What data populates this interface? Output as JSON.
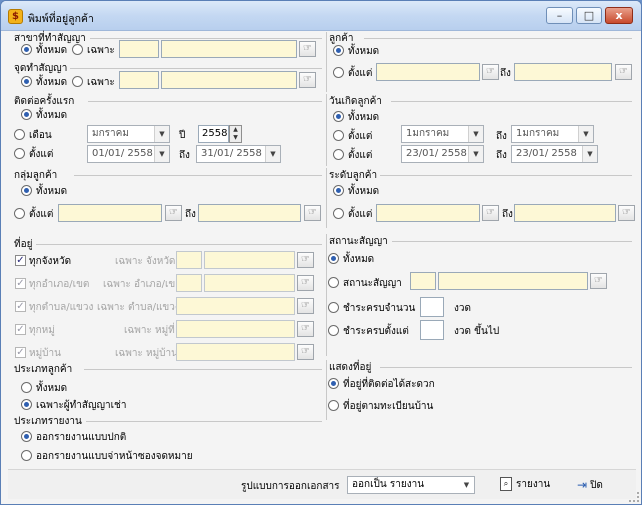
{
  "window": {
    "title": "พิมพ์ที่อยู่ลูกค้า",
    "minimize": "–",
    "maximize": "□",
    "close": "x"
  },
  "branch": {
    "title": "สาขาที่ทำสัญญา",
    "all": "ทั้งหมด",
    "specific": "เฉพาะ"
  },
  "contract_point": {
    "title": "จุดทำสัญญา",
    "all": "ทั้งหมด",
    "specific": "เฉพาะ"
  },
  "customer": {
    "title": "ลูกค้า",
    "all": "ทั้งหมด",
    "from": "ตั้งแต่",
    "to": "ถึง"
  },
  "first_contact": {
    "title": "ติดต่อครั้งแรก",
    "all": "ทั้งหมด",
    "month": "เดือน",
    "month_value": "มกราคม",
    "year_label": "ปี",
    "year_value": "2558",
    "from": "ตั้งแต่",
    "date_from": "01/01/ 2558",
    "to": "ถึง",
    "date_to": "31/01/ 2558"
  },
  "birthday": {
    "title": "วันเกิดลูกค้า",
    "all": "ทั้งหมด",
    "from": "ตั้งแต่",
    "month_from": "1มกราคม",
    "to": "ถึง",
    "month_to": "1มกราคม",
    "from2": "ตั้งแต่",
    "date_from": "23/01/ 2558",
    "to2": "ถึง",
    "date_to": "23/01/ 2558"
  },
  "customer_group": {
    "title": "กลุ่มลูกค้า",
    "all": "ทั้งหมด",
    "from": "ตั้งแต่",
    "to": "ถึง"
  },
  "customer_level": {
    "title": "ระดับลูกค้า",
    "all": "ทั้งหมด",
    "from": "ตั้งแต่",
    "to": "ถึง"
  },
  "address": {
    "title": "ที่อยู่",
    "rows": [
      {
        "check": "ทุกจังหวัด",
        "specific": "เฉพาะ จังหวัด"
      },
      {
        "check": "ทุกอำเภอ/เขต",
        "specific": "เฉพาะ อำเภอ/เขต"
      },
      {
        "check": "ทุกตำบล/แขวง",
        "specific": "เฉพาะ ตำบล/แขวง"
      },
      {
        "check": "ทุกหมู่",
        "specific": "เฉพาะ หมู่ที่"
      },
      {
        "check": "หมู่บ้าน",
        "specific": "เฉพาะ หมู่บ้าน"
      }
    ]
  },
  "contract_status": {
    "title": "สถานะสัญญา",
    "all": "ทั้งหมด",
    "status": "สถานะสัญญา",
    "paid_exact": "ชำระครบจำนวน",
    "installment": "งวด",
    "paid_from": "ชำระครบตั้งแต่",
    "installment_up": "งวด ขึ้นไป"
  },
  "customer_type": {
    "title": "ประเภทลูกค้า",
    "all": "ทั้งหมด",
    "renter_only": "เฉพาะผู้ทำสัญญาเช่า"
  },
  "show_address": {
    "title": "แสดงที่อยู่",
    "contact": "ที่อยู่ที่ติดต่อได้สะดวก",
    "registered": "ที่อยู่ตามทะเบียนบ้าน"
  },
  "report_type": {
    "title": "ประเภทรายงาน",
    "normal": "ออกรายงานแบบปกติ",
    "envelope": "ออกรายงานแบบจ่าหน้าซองจดหมาย"
  },
  "footer": {
    "format_label": "รูปแบบการออกเอกสาร",
    "format_value": "ออกเป็น รายงาน",
    "report_button": "รายงาน",
    "close_button": "ปิด"
  },
  "colors": {
    "field_yellow": "#fdf8d6",
    "radio_accent": "#2f5fb0",
    "title_bar": "#c4d8f2"
  }
}
